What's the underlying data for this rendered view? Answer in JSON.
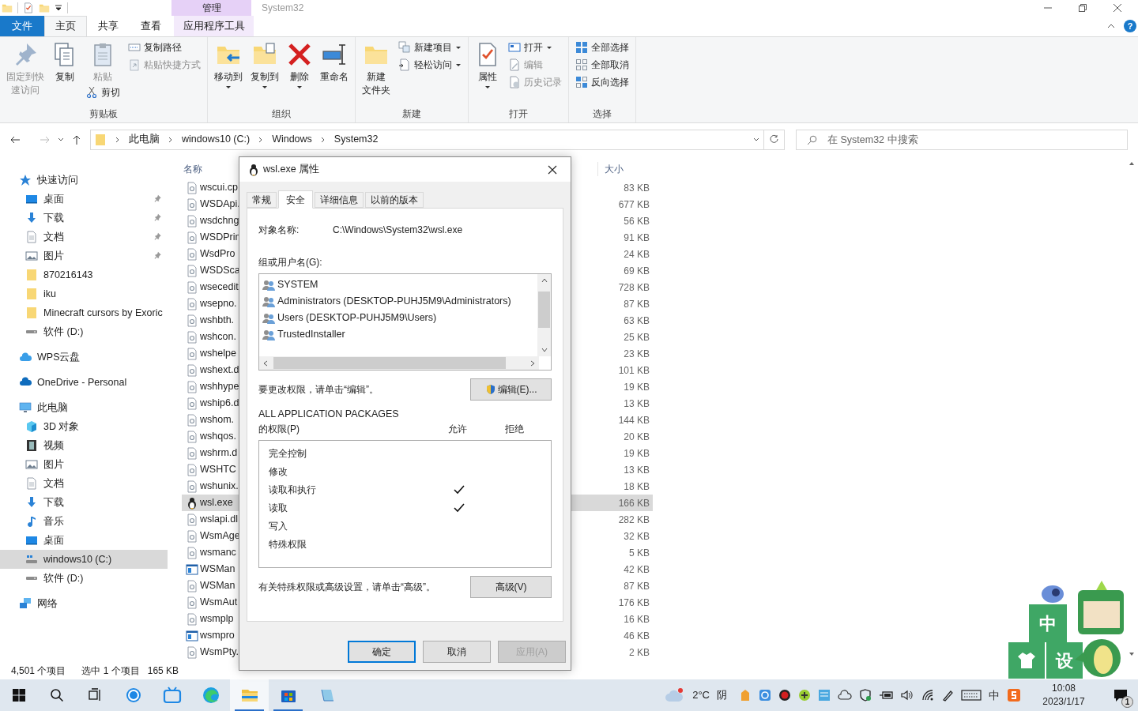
{
  "explorer": {
    "context_tab": "管理",
    "window_title": "System32",
    "ribbon_tabs": [
      {
        "label": "文件",
        "kind": "file",
        "selected": false
      },
      {
        "label": "主页",
        "kind": "tab",
        "selected": true
      },
      {
        "label": "共享",
        "kind": "tab",
        "selected": false
      },
      {
        "label": "查看",
        "kind": "tab",
        "selected": false
      },
      {
        "label": "应用程序工具",
        "kind": "context",
        "selected": false
      }
    ],
    "help": "?",
    "ribbon_groups": [
      {
        "label": "剪贴板",
        "columns": [
          {
            "items": [
              {
                "kind": "large",
                "lines": [
                  "固定到快",
                  "速访问"
                ],
                "disabled": true,
                "dropdown": false
              }
            ]
          },
          {
            "items": [
              {
                "kind": "large",
                "label": "复制",
                "disabled": false,
                "dropdown": false
              }
            ]
          },
          {
            "items": [
              {
                "kind": "large",
                "label": "粘贴",
                "disabled": true,
                "dropdown": false
              },
              {
                "kind": "small",
                "label": "剪切",
                "disabled": false,
                "dropdown": false
              }
            ]
          },
          {
            "items": [
              {
                "kind": "small",
                "label": "复制路径",
                "disabled": false,
                "dropdown": false
              },
              {
                "kind": "small",
                "label": "粘贴快捷方式",
                "disabled": true,
                "dropdown": false
              }
            ]
          }
        ]
      },
      {
        "label": "组织",
        "columns": [
          {
            "items": [
              {
                "kind": "large",
                "label": "移动到",
                "disabled": false,
                "dropdown": true
              }
            ]
          },
          {
            "items": [
              {
                "kind": "large",
                "label": "复制到",
                "disabled": false,
                "dropdown": true
              }
            ]
          },
          {
            "items": [
              {
                "kind": "large",
                "label": "删除",
                "disabled": false,
                "dropdown": true
              }
            ]
          },
          {
            "items": [
              {
                "kind": "large",
                "label": "重命名",
                "disabled": false,
                "dropdown": false
              }
            ]
          }
        ]
      },
      {
        "label": "新建",
        "columns": [
          {
            "items": [
              {
                "kind": "large",
                "lines": [
                  "新建",
                  "文件夹"
                ],
                "disabled": false,
                "dropdown": false
              }
            ]
          },
          {
            "items": [
              {
                "kind": "small",
                "label": "新建项目",
                "disabled": false,
                "dropdown": true
              },
              {
                "kind": "small",
                "label": "轻松访问",
                "disabled": false,
                "dropdown": true
              }
            ]
          }
        ]
      },
      {
        "label": "打开",
        "columns": [
          {
            "items": [
              {
                "kind": "large",
                "label": "属性",
                "disabled": false,
                "dropdown": true
              }
            ]
          },
          {
            "items": [
              {
                "kind": "small",
                "label": "打开",
                "disabled": false,
                "dropdown": true
              },
              {
                "kind": "small",
                "label": "编辑",
                "disabled": true,
                "dropdown": false
              },
              {
                "kind": "small",
                "label": "历史记录",
                "disabled": true,
                "dropdown": false
              }
            ]
          }
        ]
      },
      {
        "label": "选择",
        "columns": [
          {
            "items": [
              {
                "kind": "small",
                "label": "全部选择",
                "disabled": false,
                "dropdown": false
              },
              {
                "kind": "small",
                "label": "全部取消",
                "disabled": false,
                "dropdown": false
              },
              {
                "kind": "small",
                "label": "反向选择",
                "disabled": false,
                "dropdown": false
              }
            ]
          }
        ]
      }
    ],
    "breadcrumbs": [
      "此电脑",
      "windows10 (C:)",
      "Windows",
      "System32"
    ],
    "search": {
      "placeholder": "在 System32 中搜索"
    },
    "nav_tree": [
      {
        "label": "快速访问",
        "selected": false,
        "pinned": false,
        "children": [
          {
            "label": "桌面",
            "selected": false,
            "pinned": true
          },
          {
            "label": "下载",
            "selected": false,
            "pinned": true
          },
          {
            "label": "文档",
            "selected": false,
            "pinned": true
          },
          {
            "label": "图片",
            "selected": false,
            "pinned": true
          },
          {
            "label": "870216143",
            "selected": false,
            "pinned": false
          },
          {
            "label": "iku",
            "selected": false,
            "pinned": false
          },
          {
            "label": "Minecraft cursors by Exoric",
            "selected": false,
            "pinned": false
          },
          {
            "label": "软件 (D:)",
            "selected": false,
            "pinned": false
          }
        ]
      },
      {
        "label": "WPS云盘",
        "selected": false,
        "pinned": false
      },
      {
        "label": "OneDrive - Personal",
        "selected": false,
        "pinned": false
      },
      {
        "label": "此电脑",
        "selected": false,
        "pinned": false,
        "children": [
          {
            "label": "3D 对象",
            "selected": false,
            "pinned": false
          },
          {
            "label": "视频",
            "selected": false,
            "pinned": false
          },
          {
            "label": "图片",
            "selected": false,
            "pinned": false
          },
          {
            "label": "文档",
            "selected": false,
            "pinned": false
          },
          {
            "label": "下载",
            "selected": false,
            "pinned": false
          },
          {
            "label": "音乐",
            "selected": false,
            "pinned": false
          },
          {
            "label": "桌面",
            "selected": false,
            "pinned": false
          },
          {
            "label": "windows10 (C:)",
            "selected": true,
            "pinned": false
          },
          {
            "label": "软件 (D:)",
            "selected": false,
            "pinned": false
          }
        ]
      },
      {
        "label": "网络",
        "selected": false,
        "pinned": false
      }
    ],
    "file_list": {
      "columns": [
        "名称",
        "大小"
      ],
      "rows": [
        {
          "name": "wscui.cp",
          "size": "83 KB",
          "selected": false
        },
        {
          "name": "WSDApi.",
          "size": "677 KB",
          "selected": false
        },
        {
          "name": "wsdchng",
          "size": "56 KB",
          "selected": false
        },
        {
          "name": "WSDPrin",
          "size": "91 KB",
          "selected": false
        },
        {
          "name": "WsdPro",
          "size": "24 KB",
          "selected": false
        },
        {
          "name": "WSDSca",
          "size": "69 KB",
          "selected": false
        },
        {
          "name": "wsecedit",
          "size": "728 KB",
          "selected": false
        },
        {
          "name": "wsepno.",
          "size": "87 KB",
          "selected": false
        },
        {
          "name": "wshbth.",
          "size": "63 KB",
          "selected": false
        },
        {
          "name": "wshcon.",
          "size": "25 KB",
          "selected": false
        },
        {
          "name": "wshelpe",
          "size": "23 KB",
          "selected": false
        },
        {
          "name": "wshext.d",
          "size": "101 KB",
          "selected": false
        },
        {
          "name": "wshhype",
          "size": "19 KB",
          "selected": false
        },
        {
          "name": "wship6.d",
          "size": "13 KB",
          "selected": false
        },
        {
          "name": "wshom.",
          "size": "144 KB",
          "selected": false
        },
        {
          "name": "wshqos.",
          "size": "20 KB",
          "selected": false
        },
        {
          "name": "wshrm.d",
          "size": "19 KB",
          "selected": false
        },
        {
          "name": "WSHTC",
          "size": "13 KB",
          "selected": false
        },
        {
          "name": "wshunix.",
          "size": "18 KB",
          "selected": false
        },
        {
          "name": "wsl.exe",
          "size": "166 KB",
          "selected": true
        },
        {
          "name": "wslapi.dl",
          "size": "282 KB",
          "selected": false
        },
        {
          "name": "WsmAge",
          "size": "32 KB",
          "selected": false
        },
        {
          "name": "wsmanc",
          "size": "5 KB",
          "selected": false
        },
        {
          "name": "WSMan",
          "size": "42 KB",
          "selected": false
        },
        {
          "name": "WSMan",
          "size": "87 KB",
          "selected": false
        },
        {
          "name": "WsmAut",
          "size": "176 KB",
          "selected": false
        },
        {
          "name": "wsmplp",
          "size": "16 KB",
          "selected": false
        },
        {
          "name": "wsmpro",
          "size": "46 KB",
          "selected": false
        },
        {
          "name": "WsmPty.",
          "size": "2 KB",
          "selected": false
        }
      ]
    },
    "status_bar": {
      "item_count": "4,501 个项目",
      "selection": "选中 1 个项目",
      "selection_size": "165 KB"
    }
  },
  "dialog": {
    "title": "wsl.exe 属性",
    "tabs": [
      {
        "label": "常规",
        "selected": false
      },
      {
        "label": "安全",
        "selected": true
      },
      {
        "label": "详细信息",
        "selected": false
      },
      {
        "label": "以前的版本",
        "selected": false
      }
    ],
    "object_name_label": "对象名称:",
    "object_name": "C:\\Windows\\System32\\wsl.exe",
    "groups_label": "组或用户名(G):",
    "groups": [
      "SYSTEM",
      "Administrators (DESKTOP-PUHJ5M9\\Administrators)",
      "Users (DESKTOP-PUHJ5M9\\Users)",
      "TrustedInstaller"
    ],
    "edit_hint": "要更改权限，请单击“编辑”。",
    "edit_button": "编辑(E)...",
    "permissions_for": "ALL APPLICATION PACKAGES",
    "permissions_label": "的权限(P)",
    "allow_header": "允许",
    "deny_header": "拒绝",
    "permissions": [
      {
        "name": "完全控制",
        "allow": false,
        "deny": false
      },
      {
        "name": "修改",
        "allow": false,
        "deny": false
      },
      {
        "name": "读取和执行",
        "allow": true,
        "deny": false
      },
      {
        "name": "读取",
        "allow": true,
        "deny": false
      },
      {
        "name": "写入",
        "allow": false,
        "deny": false
      },
      {
        "name": "特殊权限",
        "allow": false,
        "deny": false
      }
    ],
    "advanced_hint": "有关特殊权限或高级设置，请单击“高级”。",
    "advanced_button": "高级(V)",
    "buttons": [
      {
        "label": "确定",
        "kind": "default",
        "disabled": false
      },
      {
        "label": "取消",
        "kind": "normal",
        "disabled": false
      },
      {
        "label": "应用(A)",
        "kind": "normal",
        "disabled": true
      }
    ]
  },
  "taskbar": {
    "apps": [
      {
        "running": false,
        "active": false
      },
      {
        "running": false,
        "active": false
      },
      {
        "running": false,
        "active": false
      },
      {
        "running": true,
        "active": true
      },
      {
        "running": true,
        "active": false
      },
      {
        "running": false,
        "active": false
      }
    ],
    "temperature": "2°C",
    "weather": "阴",
    "ime": "中",
    "time": "10:08",
    "date": "2023/1/17",
    "notification_count": "1"
  },
  "desktop_widget": {
    "labels": [
      "中",
      "设"
    ]
  }
}
